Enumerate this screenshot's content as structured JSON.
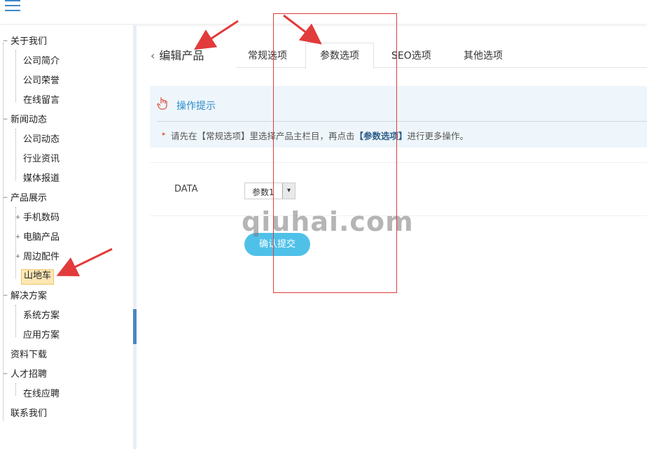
{
  "sidebar": {
    "items": [
      {
        "label": "关于我们"
      },
      {
        "label": "公司简介"
      },
      {
        "label": "公司荣誉"
      },
      {
        "label": "在线留言"
      },
      {
        "label": "新闻动态"
      },
      {
        "label": "公司动态"
      },
      {
        "label": "行业资讯"
      },
      {
        "label": "媒体报道"
      },
      {
        "label": "产品展示"
      },
      {
        "label": "手机数码"
      },
      {
        "label": "电脑产品"
      },
      {
        "label": "周边配件"
      },
      {
        "label": "山地车"
      },
      {
        "label": "解决方案"
      },
      {
        "label": "系统方案"
      },
      {
        "label": "应用方案"
      },
      {
        "label": "资料下载"
      },
      {
        "label": "人才招聘"
      },
      {
        "label": "在线应聘"
      },
      {
        "label": "联系我们"
      }
    ]
  },
  "header": {
    "back_label": "编辑产品"
  },
  "tabs": [
    {
      "label": "常规选项"
    },
    {
      "label": "参数选项"
    },
    {
      "label": "SEO选项"
    },
    {
      "label": "其他选项"
    }
  ],
  "tip": {
    "title": "操作提示",
    "text_prefix": "请先在【常规选项】里选择产品主栏目，再点击",
    "text_bold": "【参数选项】",
    "text_suffix": "进行更多操作。"
  },
  "form": {
    "field_label": "DATA",
    "select_value": "参数1",
    "submit_label": "确认提交"
  },
  "watermark": "qiuhai.com",
  "colors": {
    "accent": "#4fc1e9",
    "annotation": "#e23b3b",
    "link": "#2d8ec8"
  }
}
